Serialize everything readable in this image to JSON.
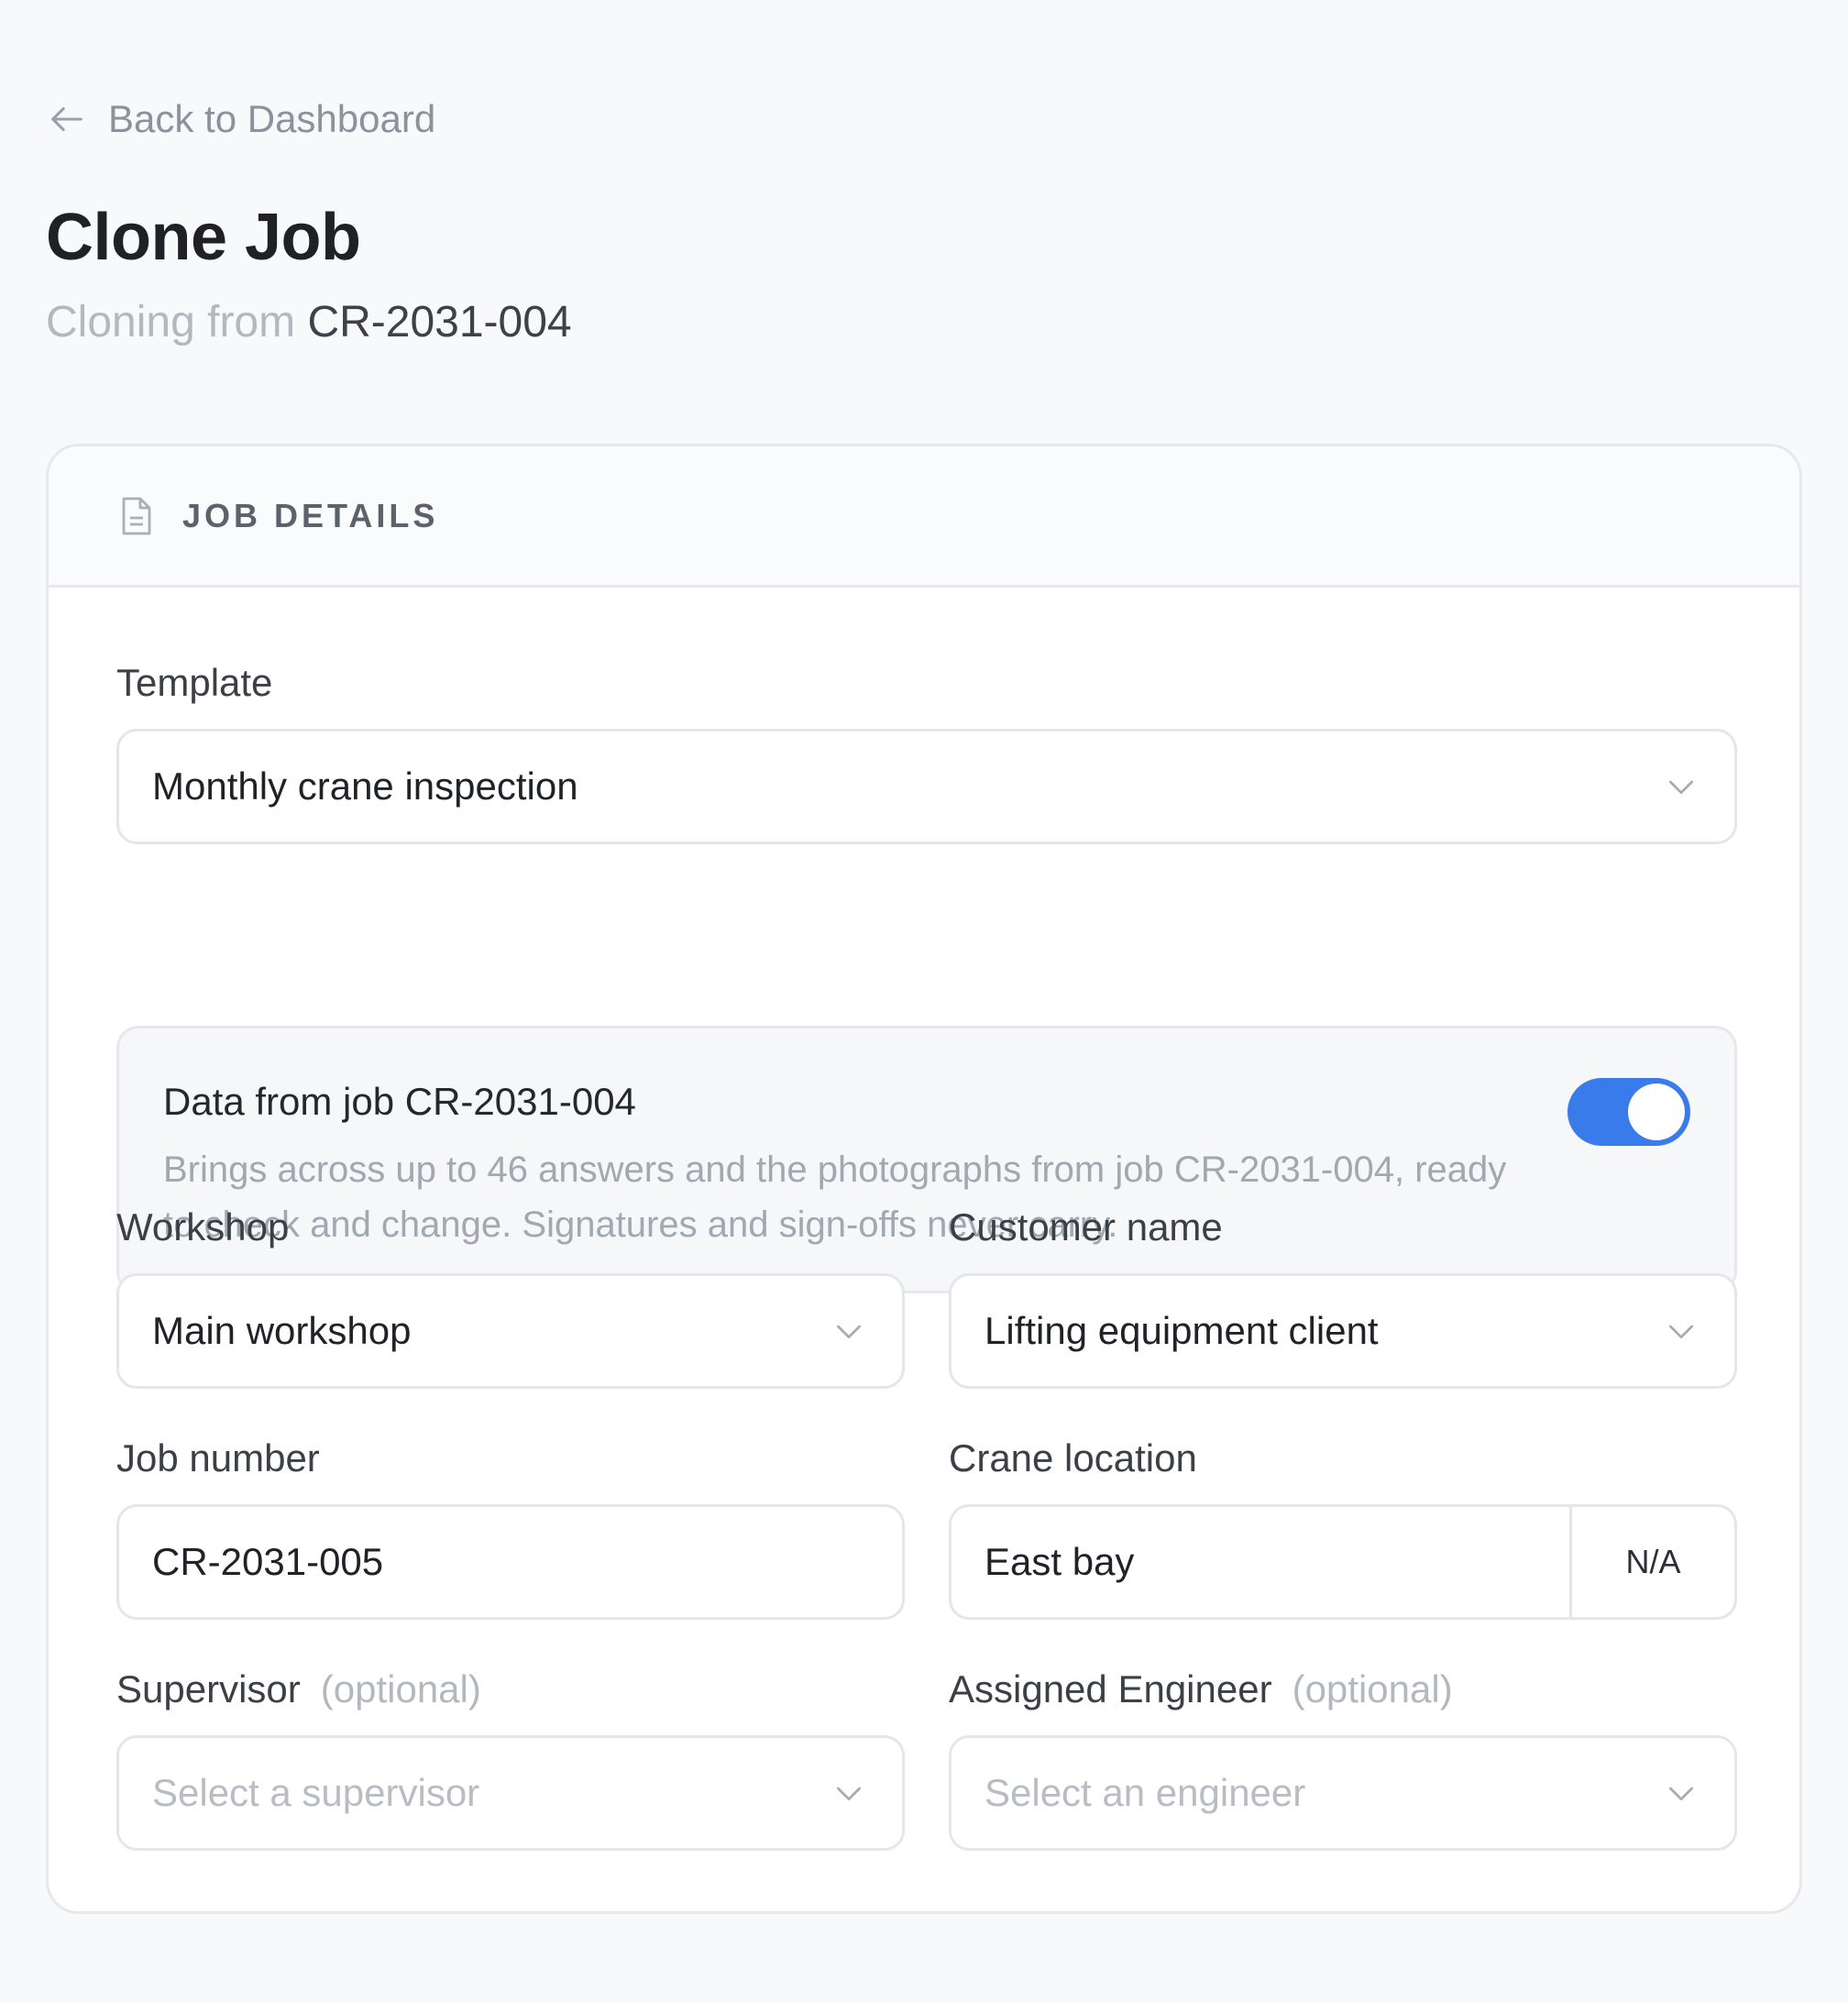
{
  "nav": {
    "back_label": "Back to Dashboard"
  },
  "header": {
    "title": "Clone Job",
    "subtitle_prefix": "Cloning from",
    "source_job": "CR-2031-004"
  },
  "card": {
    "section_title": "JOB DETAILS"
  },
  "form": {
    "template": {
      "label": "Template",
      "value": "Monthly crane inspection"
    },
    "carry_over": {
      "title": "Data from job CR-2031-004",
      "description": "Brings across up to 46 answers and the photographs from job CR-2031-004, ready to check and change. Signatures and sign-offs never carry.",
      "enabled": true
    },
    "workshop": {
      "label": "Workshop",
      "value": "Main workshop"
    },
    "customer": {
      "label": "Customer name",
      "value": "Lifting equipment client"
    },
    "job_number": {
      "label": "Job number",
      "value": "CR-2031-005"
    },
    "crane_location": {
      "label": "Crane location",
      "value": "East bay",
      "suffix": "N/A"
    },
    "supervisor": {
      "label": "Supervisor",
      "optional": "(optional)",
      "placeholder": "Select a supervisor"
    },
    "engineer": {
      "label": "Assigned Engineer",
      "optional": "(optional)",
      "placeholder": "Select an engineer"
    }
  },
  "colors": {
    "accent": "#3a7bec",
    "background": "#f8f9fb",
    "muted_text": "#b3b8bf"
  },
  "icons": {
    "back": "arrow-left-icon",
    "section": "document-icon",
    "dropdown": "chevron-down-icon"
  }
}
